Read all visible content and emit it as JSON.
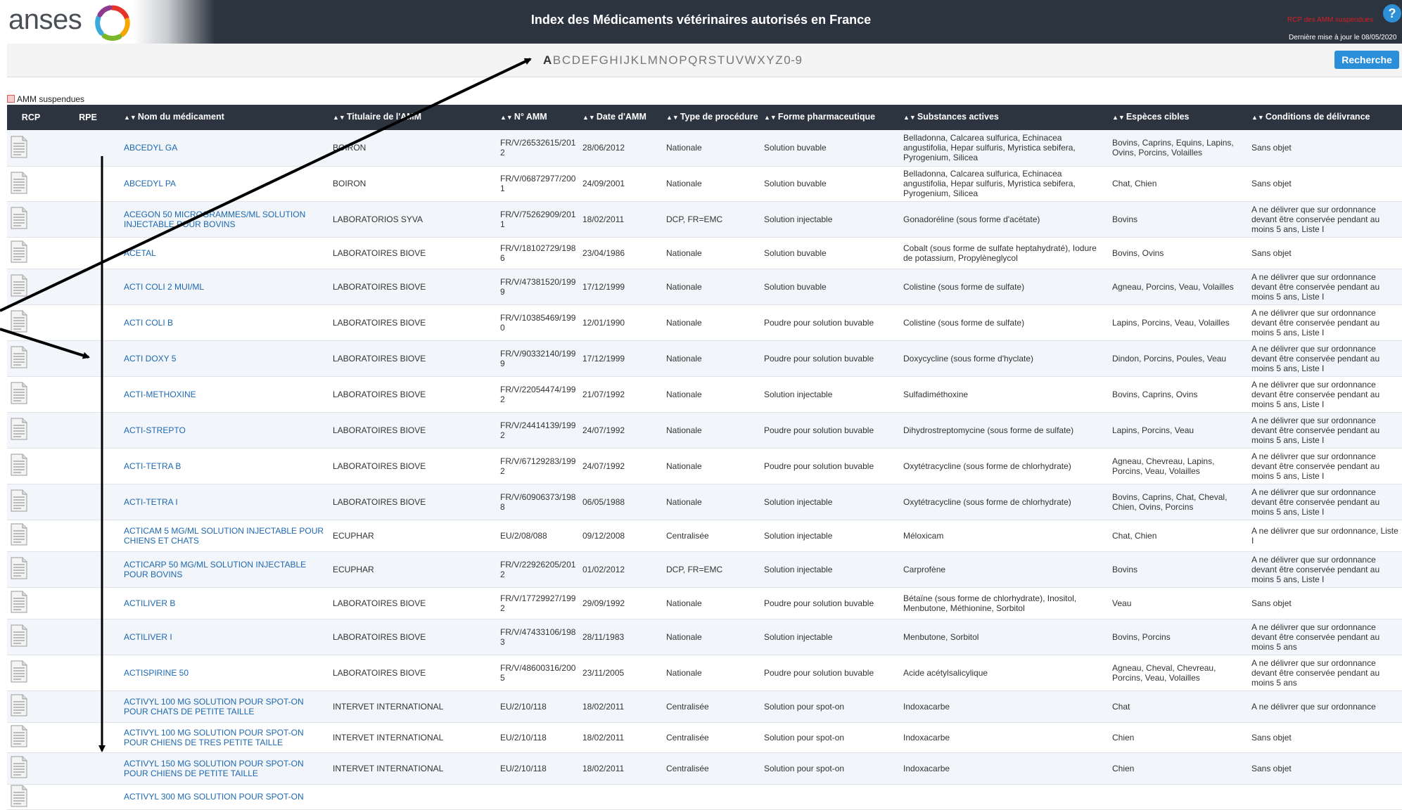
{
  "header": {
    "logo_text": "anses",
    "title": "Index des Médicaments vétérinaires autorisés en France",
    "red_link": "RCP des AMM suspendues",
    "last_update": "Dernière mise à jour le 08/05/2020",
    "help_label": "?"
  },
  "alphabet": [
    "A",
    "B",
    "C",
    "D",
    "E",
    "F",
    "G",
    "H",
    "I",
    "J",
    "K",
    "L",
    "M",
    "N",
    "O",
    "P",
    "Q",
    "R",
    "S",
    "T",
    "U",
    "V",
    "W",
    "X",
    "Y",
    "Z",
    "0-9"
  ],
  "active_letter": "A",
  "search_button": "Recherche",
  "legend_label": "AMM suspendues",
  "columns": {
    "rcp": "RCP",
    "rpe": "RPE",
    "name": "Nom du médicament",
    "holder": "Titulaire de l'AMM",
    "amm": "N° AMM",
    "date": "Date d'AMM",
    "procedure": "Type de procédure",
    "form": "Forme pharmaceutique",
    "substances": "Substances actives",
    "species": "Espèces cibles",
    "conditions": "Conditions de délivrance"
  },
  "rows": [
    {
      "name": "ABCEDYL GA",
      "holder": "BOIRON",
      "amm": "FR/V/26532615/2012",
      "date": "28/06/2012",
      "procedure": "Nationale",
      "form": "Solution buvable",
      "substances": "Belladonna, Calcarea sulfurica, Echinacea angustifolia, Hepar sulfuris, Myristica sebifera, Pyrogenium, Silicea",
      "species": "Bovins, Caprins, Equins, Lapins, Ovins, Porcins, Volailles",
      "conditions": "Sans objet"
    },
    {
      "name": "ABCEDYL PA",
      "holder": "BOIRON",
      "amm": "FR/V/06872977/2001",
      "date": "24/09/2001",
      "procedure": "Nationale",
      "form": "Solution buvable",
      "substances": "Belladonna, Calcarea sulfurica, Echinacea angustifolia, Hepar sulfuris, Myristica sebifera, Pyrogenium, Silicea",
      "species": "Chat, Chien",
      "conditions": "Sans objet"
    },
    {
      "name": "ACEGON 50 MICROGRAMMES/ML SOLUTION INJECTABLE POUR BOVINS",
      "holder": "LABORATORIOS SYVA",
      "amm": "FR/V/75262909/2011",
      "date": "18/02/2011",
      "procedure": "DCP, FR=EMC",
      "form": "Solution injectable",
      "substances": "Gonadoréline (sous forme d'acétate)",
      "species": "Bovins",
      "conditions": "A ne délivrer que sur ordonnance devant être conservée pendant au moins 5 ans, Liste I"
    },
    {
      "name": "ACETAL",
      "holder": "LABORATOIRES BIOVE",
      "amm": "FR/V/18102729/1986",
      "date": "23/04/1986",
      "procedure": "Nationale",
      "form": "Solution buvable",
      "substances": "Cobalt (sous forme de sulfate heptahydraté), Iodure de potassium, Propylèneglycol",
      "species": "Bovins, Ovins",
      "conditions": "Sans objet"
    },
    {
      "name": "ACTI COLI 2 MUI/ML",
      "holder": "LABORATOIRES BIOVE",
      "amm": "FR/V/47381520/1999",
      "date": "17/12/1999",
      "procedure": "Nationale",
      "form": "Solution buvable",
      "substances": "Colistine (sous forme de sulfate)",
      "species": "Agneau, Porcins, Veau, Volailles",
      "conditions": "A ne délivrer que sur ordonnance devant être conservée pendant au moins 5 ans, Liste I"
    },
    {
      "name": "ACTI COLI B",
      "holder": "LABORATOIRES BIOVE",
      "amm": "FR/V/10385469/1990",
      "date": "12/01/1990",
      "procedure": "Nationale",
      "form": "Poudre pour solution buvable",
      "substances": "Colistine (sous forme de sulfate)",
      "species": "Lapins, Porcins, Veau, Volailles",
      "conditions": "A ne délivrer que sur ordonnance devant être conservée pendant au moins 5 ans, Liste I"
    },
    {
      "name": "ACTI DOXY 5",
      "holder": "LABORATOIRES BIOVE",
      "amm": "FR/V/90332140/1999",
      "date": "17/12/1999",
      "procedure": "Nationale",
      "form": "Poudre pour solution buvable",
      "substances": "Doxycycline (sous forme d'hyclate)",
      "species": "Dindon, Porcins, Poules, Veau",
      "conditions": "A ne délivrer que sur ordonnance devant être conservée pendant au moins 5 ans, Liste I"
    },
    {
      "name": "ACTI-METHOXINE",
      "holder": "LABORATOIRES BIOVE",
      "amm": "FR/V/22054474/1992",
      "date": "21/07/1992",
      "procedure": "Nationale",
      "form": "Solution injectable",
      "substances": "Sulfadiméthoxine",
      "species": "Bovins, Caprins, Ovins",
      "conditions": "A ne délivrer que sur ordonnance devant être conservée pendant au moins 5 ans, Liste I"
    },
    {
      "name": "ACTI-STREPTO",
      "holder": "LABORATOIRES BIOVE",
      "amm": "FR/V/24414139/1992",
      "date": "24/07/1992",
      "procedure": "Nationale",
      "form": "Poudre pour solution buvable",
      "substances": "Dihydrostreptomycine (sous forme de sulfate)",
      "species": "Lapins, Porcins, Veau",
      "conditions": "A ne délivrer que sur ordonnance devant être conservée pendant au moins 5 ans, Liste I"
    },
    {
      "name": "ACTI-TETRA B",
      "holder": "LABORATOIRES BIOVE",
      "amm": "FR/V/67129283/1992",
      "date": "24/07/1992",
      "procedure": "Nationale",
      "form": "Poudre pour solution buvable",
      "substances": "Oxytétracycline (sous forme de chlorhydrate)",
      "species": "Agneau, Chevreau, Lapins, Porcins, Veau, Volailles",
      "conditions": "A ne délivrer que sur ordonnance devant être conservée pendant au moins 5 ans, Liste I"
    },
    {
      "name": "ACTI-TETRA I",
      "holder": "LABORATOIRES BIOVE",
      "amm": "FR/V/60906373/1988",
      "date": "06/05/1988",
      "procedure": "Nationale",
      "form": "Solution injectable",
      "substances": "Oxytétracycline (sous forme de chlorhydrate)",
      "species": "Bovins, Caprins, Chat, Cheval, Chien, Ovins, Porcins",
      "conditions": "A ne délivrer que sur ordonnance devant être conservée pendant au moins 5 ans, Liste I"
    },
    {
      "name": "ACTICAM 5 MG/ML SOLUTION INJECTABLE POUR CHIENS ET CHATS",
      "holder": "ECUPHAR",
      "amm": "EU/2/08/088",
      "date": "09/12/2008",
      "procedure": "Centralisée",
      "form": "Solution injectable",
      "substances": "Méloxicam",
      "species": "Chat, Chien",
      "conditions": "A ne délivrer que sur ordonnance, Liste I"
    },
    {
      "name": "ACTICARP 50 MG/ML SOLUTION INJECTABLE POUR BOVINS",
      "holder": "ECUPHAR",
      "amm": "FR/V/22926205/2012",
      "date": "01/02/2012",
      "procedure": "DCP, FR=EMC",
      "form": "Solution injectable",
      "substances": "Carprofène",
      "species": "Bovins",
      "conditions": "A ne délivrer que sur ordonnance devant être conservée pendant au moins 5 ans, Liste I"
    },
    {
      "name": "ACTILIVER B",
      "holder": "LABORATOIRES BIOVE",
      "amm": "FR/V/17729927/1992",
      "date": "29/09/1992",
      "procedure": "Nationale",
      "form": "Poudre pour solution buvable",
      "substances": "Bétaïne (sous forme de chlorhydrate), Inositol, Menbutone, Méthionine, Sorbitol",
      "species": "Veau",
      "conditions": "Sans objet"
    },
    {
      "name": "ACTILIVER I",
      "holder": "LABORATOIRES BIOVE",
      "amm": "FR/V/47433106/1983",
      "date": "28/11/1983",
      "procedure": "Nationale",
      "form": "Solution injectable",
      "substances": "Menbutone, Sorbitol",
      "species": "Bovins, Porcins",
      "conditions": "A ne délivrer que sur ordonnance devant être conservée pendant au moins 5 ans"
    },
    {
      "name": "ACTISPIRINE 50",
      "holder": "LABORATOIRES BIOVE",
      "amm": "FR/V/48600316/2005",
      "date": "23/11/2005",
      "procedure": "Nationale",
      "form": "Poudre pour solution buvable",
      "substances": "Acide acétylsalicylique",
      "species": "Agneau, Cheval, Chevreau, Porcins, Veau, Volailles",
      "conditions": "A ne délivrer que sur ordonnance devant être conservée pendant au moins 5 ans"
    },
    {
      "name": "ACTIVYL 100 MG SOLUTION POUR SPOT-ON POUR CHATS DE PETITE TAILLE",
      "holder": "INTERVET INTERNATIONAL",
      "amm": "EU/2/10/118",
      "date": "18/02/2011",
      "procedure": "Centralisée",
      "form": "Solution pour spot-on",
      "substances": "Indoxacarbe",
      "species": "Chat",
      "conditions": "A ne délivrer que sur ordonnance"
    },
    {
      "name": "ACTIVYL 100 MG SOLUTION POUR SPOT-ON POUR CHIENS DE TRES PETITE TAILLE",
      "holder": "INTERVET INTERNATIONAL",
      "amm": "EU/2/10/118",
      "date": "18/02/2011",
      "procedure": "Centralisée",
      "form": "Solution pour spot-on",
      "substances": "Indoxacarbe",
      "species": "Chien",
      "conditions": "Sans objet"
    },
    {
      "name": "ACTIVYL 150 MG SOLUTION POUR SPOT-ON POUR CHIENS DE PETITE TAILLE",
      "holder": "INTERVET INTERNATIONAL",
      "amm": "EU/2/10/118",
      "date": "18/02/2011",
      "procedure": "Centralisée",
      "form": "Solution pour spot-on",
      "substances": "Indoxacarbe",
      "species": "Chien",
      "conditions": "Sans objet"
    },
    {
      "name": "ACTIVYL 300 MG SOLUTION POUR SPOT-ON",
      "holder": "",
      "amm": "",
      "date": "",
      "procedure": "",
      "form": "",
      "substances": "",
      "species": "",
      "conditions": ""
    }
  ]
}
